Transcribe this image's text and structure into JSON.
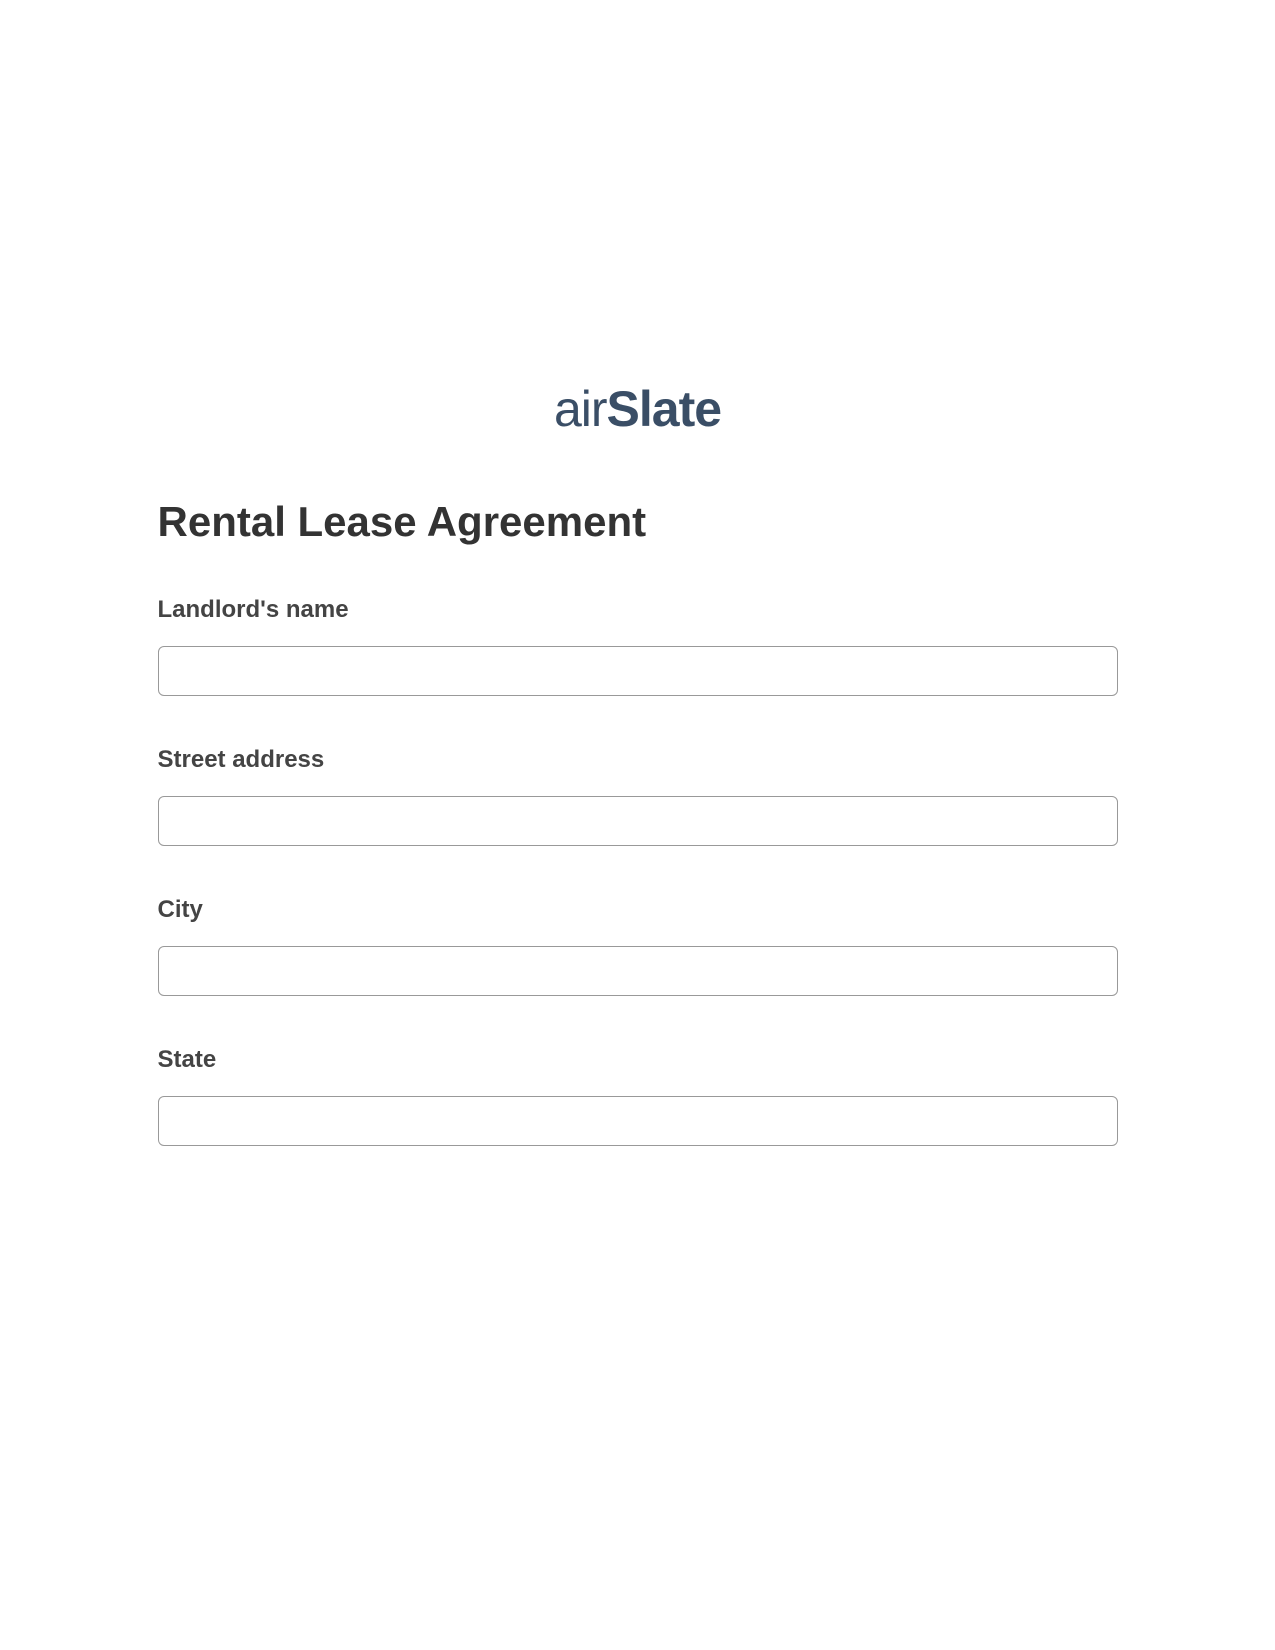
{
  "logo": {
    "part1": "air",
    "part2": "Slate"
  },
  "title": "Rental Lease Agreement",
  "fields": [
    {
      "label": "Landlord's name",
      "value": ""
    },
    {
      "label": "Street address",
      "value": ""
    },
    {
      "label": "City",
      "value": ""
    },
    {
      "label": "State",
      "value": ""
    }
  ]
}
